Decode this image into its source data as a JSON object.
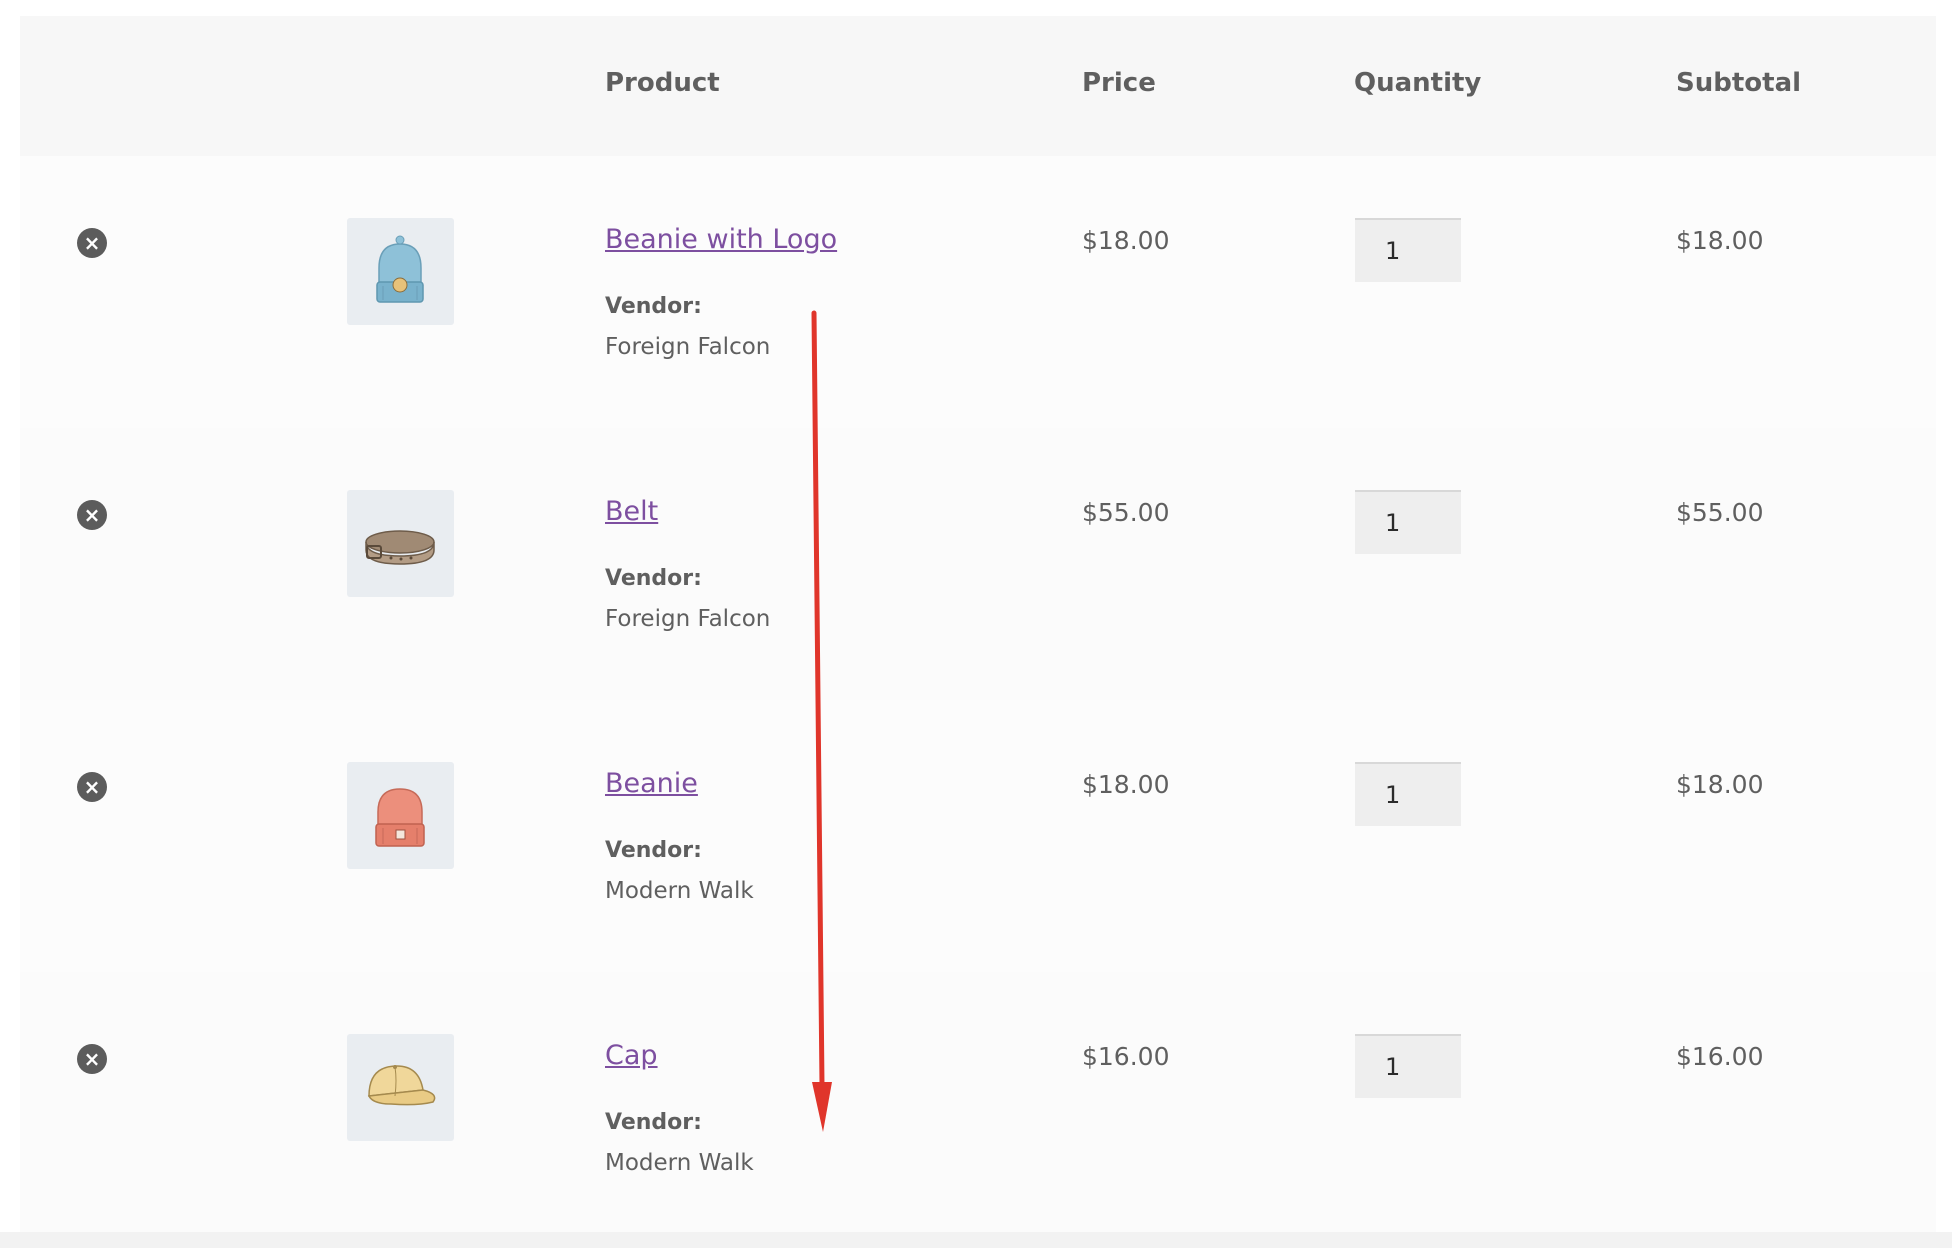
{
  "table": {
    "headers": {
      "product": "Product",
      "price": "Price",
      "quantity": "Quantity",
      "subtotal": "Subtotal"
    },
    "rows": [
      {
        "name": "Beanie with Logo",
        "vendor_label": "Vendor:",
        "vendor": "Foreign Falcon",
        "price": "$18.00",
        "quantity": "1",
        "subtotal": "$18.00",
        "image": "beanie-with-logo-image"
      },
      {
        "name": "Belt",
        "vendor_label": "Vendor:",
        "vendor": "Foreign Falcon",
        "price": "$55.00",
        "quantity": "1",
        "subtotal": "$55.00",
        "image": "belt-image"
      },
      {
        "name": "Beanie",
        "vendor_label": "Vendor:",
        "vendor": "Modern Walk",
        "price": "$18.00",
        "quantity": "1",
        "subtotal": "$18.00",
        "image": "beanie-image"
      },
      {
        "name": "Cap",
        "vendor_label": "Vendor:",
        "vendor": "Modern Walk",
        "price": "$16.00",
        "quantity": "1",
        "subtotal": "$16.00",
        "image": "cap-image"
      }
    ]
  },
  "icons": {
    "remove": "remove-item-icon"
  },
  "colors": {
    "link": "#7d4fa0",
    "header_bg": "#f7f7f7",
    "annotation_arrow": "#e0352b"
  }
}
